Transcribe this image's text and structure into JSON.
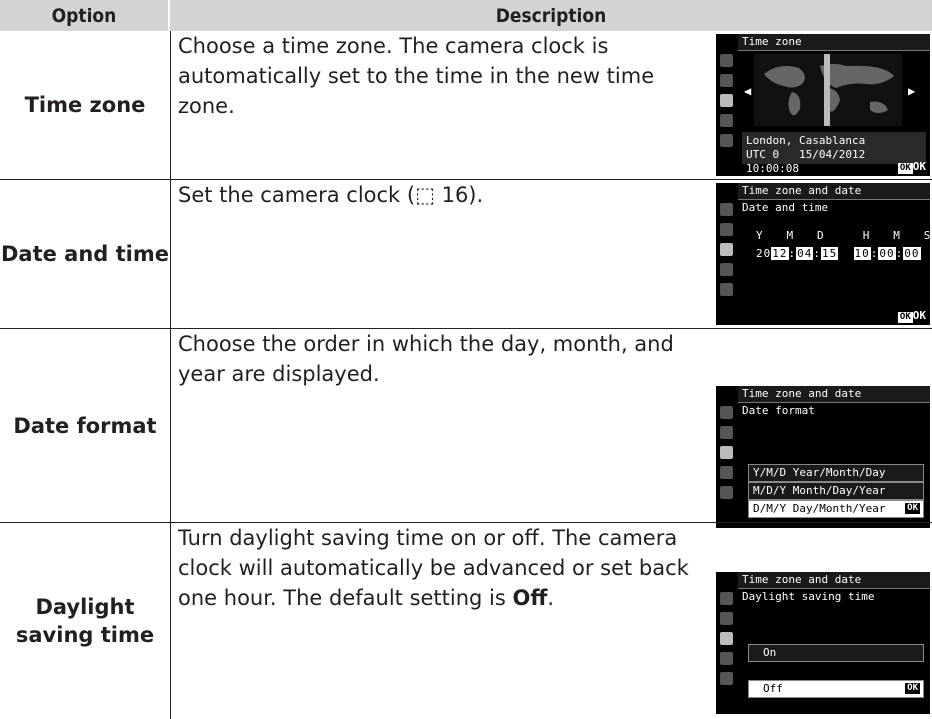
{
  "header": {
    "option": "Option",
    "description": "Description"
  },
  "rows": [
    {
      "option": "Time zone",
      "description": "Choose a time zone.  The camera clock is automatically set to the time in the new time zone.",
      "screen": {
        "title": "Time zone",
        "location": "London, Casablanca",
        "utc": "UTC 0",
        "datetime": "15/04/2012 10:00:08",
        "ok": "OK"
      }
    },
    {
      "option": "Date and time",
      "description": "Set the camera clock (⬚ 16).",
      "screen": {
        "title": "Time zone and date",
        "subtitle": "Date and time",
        "fields": "Y   M   D     H   M   S",
        "prefix": "20",
        "year": "12",
        "month": "04",
        "day": "15",
        "hour": "10",
        "minute": "00",
        "second": "00",
        "ok": "OK"
      }
    },
    {
      "option": "Date format",
      "description": "Choose the order in which the day, month, and year are displayed.",
      "screen": {
        "title": "Time zone and date",
        "subtitle": "Date format",
        "options": [
          "Y/M/D Year/Month/Day",
          "M/D/Y Month/Day/Year",
          "D/M/Y Day/Month/Year"
        ],
        "ok": "OK"
      }
    },
    {
      "option_line1": "Daylight",
      "option_line2": "saving time",
      "description_pre": "Turn daylight saving time on or off.  The camera clock will automatically be advanced or set back one hour. The default setting is ",
      "description_bold": "Off",
      "description_post": ".",
      "screen": {
        "title": "Time zone and date",
        "subtitle": "Daylight saving time",
        "options": [
          "On",
          "Off"
        ],
        "ok": "OK"
      }
    }
  ]
}
